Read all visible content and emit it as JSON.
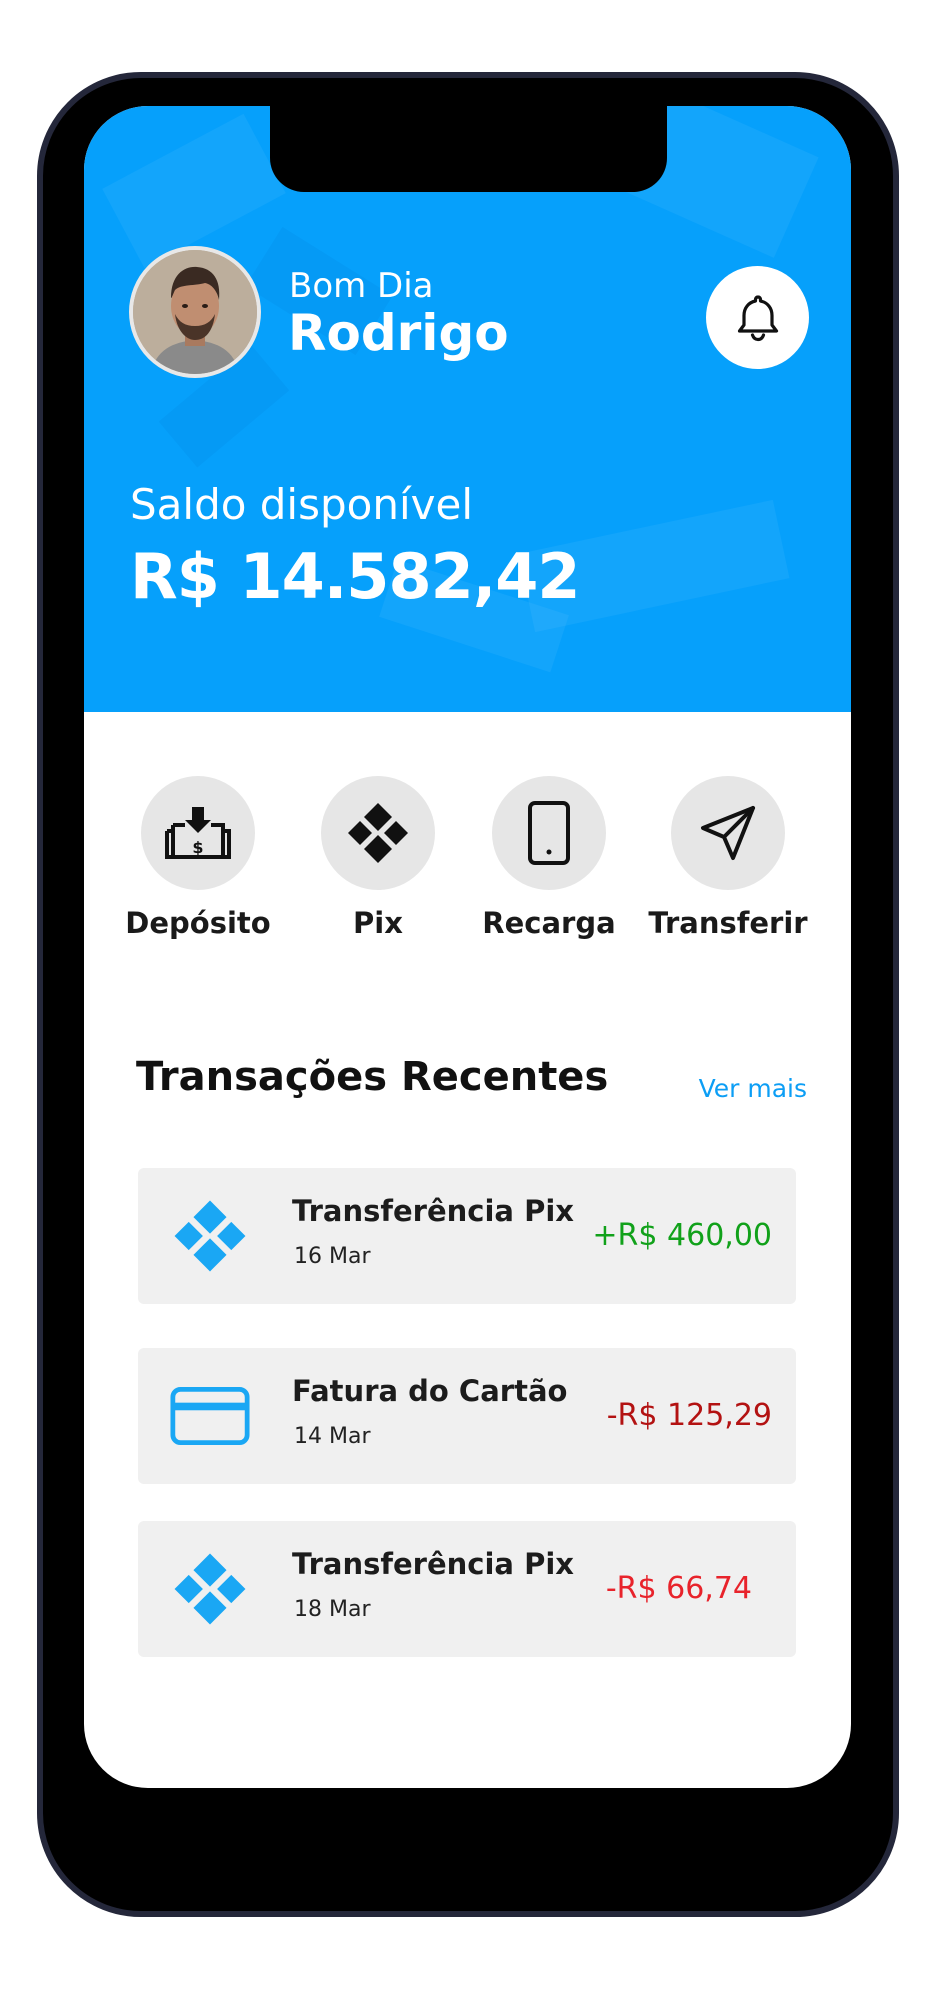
{
  "header": {
    "greeting": "Bom Dia",
    "user_name": "Rodrigo",
    "notification_icon": "bell-icon",
    "accent_color": "#06a0fb"
  },
  "balance": {
    "label": "Saldo disponível",
    "value": "R$ 14.582,42"
  },
  "actions": [
    {
      "label": "Depósito",
      "icon": "deposit-icon"
    },
    {
      "label": "Pix",
      "icon": "pix-icon"
    },
    {
      "label": "Recarga",
      "icon": "phone-icon"
    },
    {
      "label": "Transferir",
      "icon": "send-icon"
    }
  ],
  "recent": {
    "title": "Transações Recentes",
    "see_more": "Ver mais",
    "items": [
      {
        "title": "Transferência Pix",
        "date": "16 Mar",
        "amount": "+R$ 460,00",
        "icon": "pix-icon",
        "amount_color": "#11a11a"
      },
      {
        "title": "Fatura do Cartão",
        "date": "14 Mar",
        "amount": "-R$ 125,29",
        "icon": "card-icon",
        "amount_color": "#b31212"
      },
      {
        "title": "Transferência Pix",
        "date": "18 Mar",
        "amount": "-R$ 66,74",
        "icon": "pix-icon",
        "amount_color": "#e8232b"
      }
    ]
  }
}
